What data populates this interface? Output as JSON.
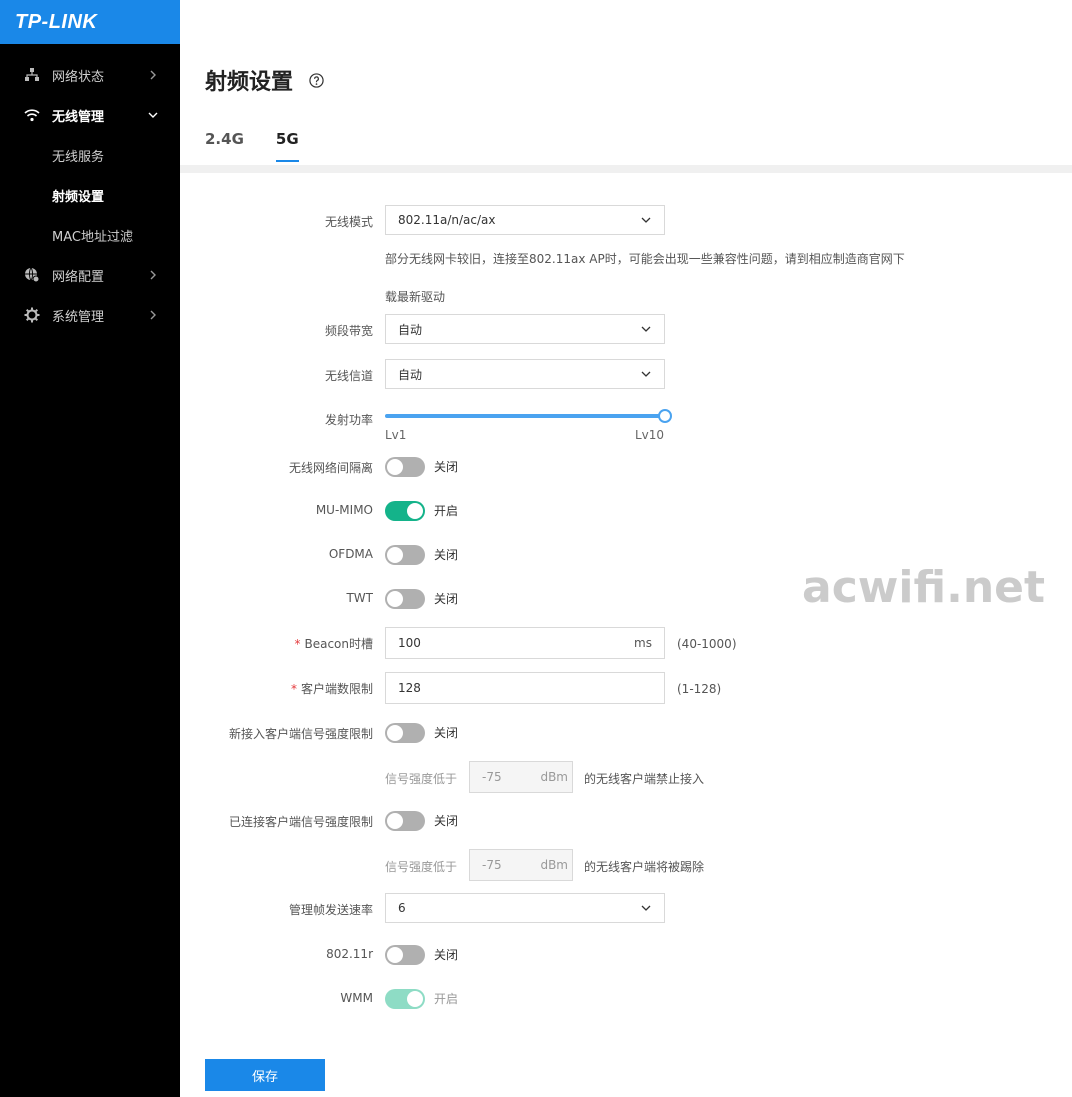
{
  "brand": {
    "logo_text": "TP-LINK",
    "accent": "#1a88e8"
  },
  "sidebar": {
    "items": [
      {
        "label": "网络状态",
        "icon": "network-topology-icon",
        "state": "collapsed"
      },
      {
        "label": "无线管理",
        "icon": "wifi-icon",
        "state": "expanded",
        "children": [
          {
            "label": "无线服务"
          },
          {
            "label": "射频设置",
            "active": true
          },
          {
            "label": "MAC地址过滤"
          }
        ]
      },
      {
        "label": "网络配置",
        "icon": "globe-gear-icon",
        "state": "collapsed"
      },
      {
        "label": "系统管理",
        "icon": "gear-icon",
        "state": "collapsed"
      }
    ]
  },
  "page": {
    "title": "射频设置",
    "tabs": [
      {
        "label": "2.4G"
      },
      {
        "label": "5G",
        "active": true
      }
    ]
  },
  "form": {
    "wireless_mode": {
      "label": "无线模式",
      "value": "802.11a/n/ac/ax"
    },
    "mode_hint": "部分无线网卡较旧，连接至802.11ax AP时，可能会出现一些兼容性问题，请到相应制造商官网下载最新驱动",
    "bandwidth": {
      "label": "频段带宽",
      "value": "自动"
    },
    "channel": {
      "label": "无线信道",
      "value": "自动"
    },
    "tx_power": {
      "label": "发射功率",
      "min_label": "Lv1",
      "max_label": "Lv10",
      "level_fraction": 1.0
    },
    "isolation": {
      "label": "无线网络间隔离",
      "on": false,
      "text": "关闭"
    },
    "mu_mimo": {
      "label": "MU-MIMO",
      "on": true,
      "text": "开启"
    },
    "ofdma": {
      "label": "OFDMA",
      "on": false,
      "text": "关闭"
    },
    "twt": {
      "label": "TWT",
      "on": false,
      "text": "关闭"
    },
    "beacon": {
      "label": "Beacon时槽",
      "required_mark": "*",
      "value": "100",
      "unit": "ms",
      "range": "(40-1000)"
    },
    "client_limit": {
      "label": "客户端数限制",
      "required_mark": "*",
      "value": "128",
      "range": "(1-128)"
    },
    "new_client_rssi": {
      "label": "新接入客户端信号强度限制",
      "on": false,
      "text": "关闭",
      "sub_label": "信号强度低于",
      "sub_value": "-75",
      "sub_unit": "dBm",
      "sub_suffix": "的无线客户端禁止接入"
    },
    "connected_client_rssi": {
      "label": "已连接客户端信号强度限制",
      "on": false,
      "text": "关闭",
      "sub_label": "信号强度低于",
      "sub_value": "-75",
      "sub_unit": "dBm",
      "sub_suffix": "的无线客户端将被踢除"
    },
    "mgmt_rate": {
      "label": "管理帧发送速率",
      "value": "6"
    },
    "dot11r": {
      "label": "802.11r",
      "on": false,
      "text": "关闭"
    },
    "wmm": {
      "label": "WMM",
      "on": true,
      "disabled": true,
      "text": "开启"
    }
  },
  "actions": {
    "save_label": "保存"
  },
  "watermark": "acwifi.net",
  "colors": {
    "toggle_on": "#14b38a",
    "toggle_off": "#b0b0b0",
    "sidebar_bg": "#000000"
  }
}
